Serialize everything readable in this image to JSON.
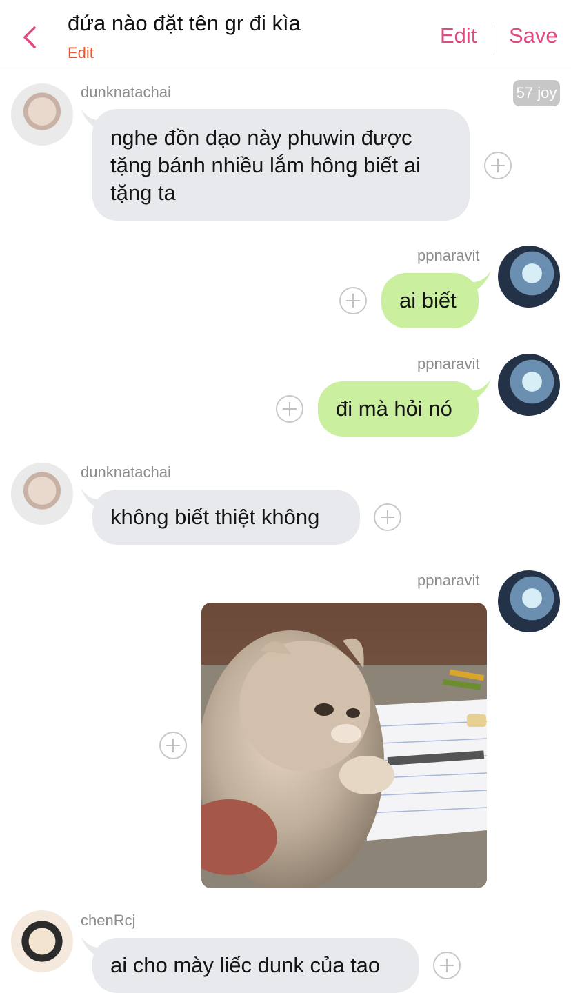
{
  "header": {
    "title": "đứa nào đặt tên gr đi kìa",
    "sub_edit": "Edit",
    "edit_label": "Edit",
    "save_label": "Save",
    "accent": "#e04a80"
  },
  "messages": [
    {
      "sender": "dunknatachai",
      "text": "nghe đồn dạo này phuwin được tặng bánh nhiều lắm hông biết ai tặng ta",
      "badge": "57 joy"
    },
    {
      "sender": "ppnaravit",
      "text": "ai biết"
    },
    {
      "sender": "ppnaravit",
      "text": "đi mà hỏi nó"
    },
    {
      "sender": "dunknatachai",
      "text": "không biết thiệt không"
    },
    {
      "sender": "ppnaravit",
      "image": "cat-photo"
    },
    {
      "sender": "chenRcj",
      "text": "ai cho mày liếc dunk của tao"
    }
  ],
  "colors": {
    "incoming_bubble": "#e7e9ed",
    "outgoing_bubble": "#c9ef9f",
    "name_gray": "#8c8c8c",
    "edit_orange": "#e8562e"
  }
}
